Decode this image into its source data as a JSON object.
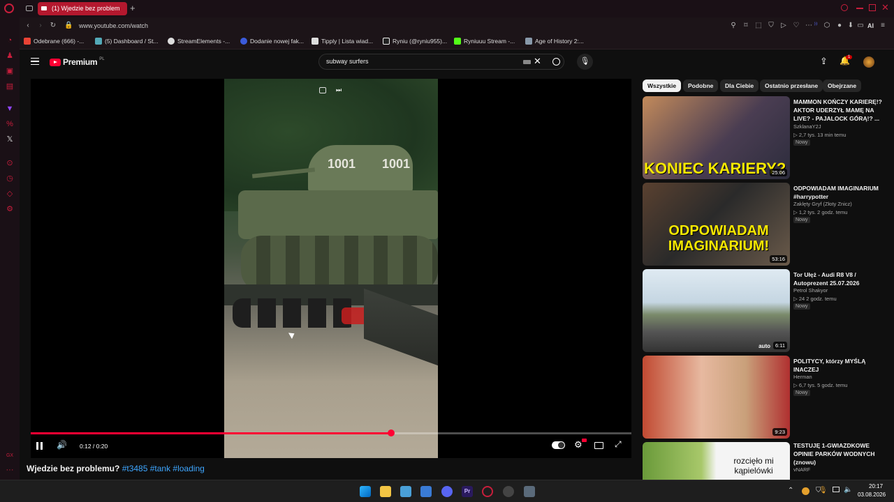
{
  "browser": {
    "tab_title": "(1) Wjedzie bez problem",
    "url": "www.youtube.com/watch",
    "bookmarks": [
      "Odebrane (666) -...",
      "(5) Dashboard / St...",
      "StreamElements -...",
      "Dodanie nowej fak...",
      "Tipply | Lista wiad...",
      "Ryniu (@ryniu955)...",
      "Ryniuuu Stream -...",
      "Age of History 2:..."
    ],
    "ai_label": "AI"
  },
  "youtube": {
    "logo": "Premium",
    "region": "PL",
    "search_value": "subway surfers",
    "notif_count": "1",
    "chips": [
      "Wszystkie",
      "Podobne",
      "Dla Ciebie",
      "Ostatnio przesłane",
      "Obejrzane"
    ],
    "player": {
      "time": "0:12 / 0:20",
      "progress": 0.6,
      "tank_text": "1001"
    },
    "video_title": "Wjedzie bez problemu?",
    "hashtags": "#t3485 #tank #loading",
    "recommendations": [
      {
        "title": "MAMMON KOŃCZY KARIERĘ!? AKTOR UDERZYŁ MAMĘ NA LIVE? - PAJALOCK GÓRĄ!? ...",
        "channel": "SzklanaY2J",
        "meta": "▷ 2,7 tys.  13 min temu",
        "badge": "Nowy",
        "duration": "25:06",
        "thumb_text": "KONIEC KARIERY?"
      },
      {
        "title": "ODPOWIADAM IMAGINARIUM #harrypotter",
        "channel": "Zaklęty Gryf (Złoty Znicz)",
        "meta": "▷ 1,2 tys.  2 godz. temu",
        "badge": "Nowy",
        "duration": "53:16",
        "thumb_text": "ODPOWIADAM IMAGINARIUM!"
      },
      {
        "title": "Tor Ułęż - Audi R8 V8 / Autoprezent 25.07.2026",
        "channel": "Petrol Shakyor",
        "meta": "▷ 24  2 godz. temu",
        "badge": "Nowy",
        "duration": "6:11",
        "thumb_text": "auto"
      },
      {
        "title": "POLITYCY, którzy MYŚLĄ INACZEJ",
        "channel": "Herman",
        "meta": "▷ 6,7 tys.  5 godz. temu",
        "badge": "Nowy",
        "duration": "9:23",
        "thumb_text": ""
      },
      {
        "title": "TESTUJĘ 1-GWIAZDKOWE OPINIE PARKÓW WODNYCH (znowu)",
        "channel": "vNARF",
        "meta": "",
        "badge": "",
        "duration": "",
        "thumb_text": "rozcięło mi kąpielówki"
      }
    ]
  },
  "taskbar": {
    "time": "20:17",
    "date": "03.08.2026"
  },
  "colors": {
    "accent": "#c81e3c",
    "yt_red": "#ff0033",
    "link": "#3ea6ff"
  }
}
